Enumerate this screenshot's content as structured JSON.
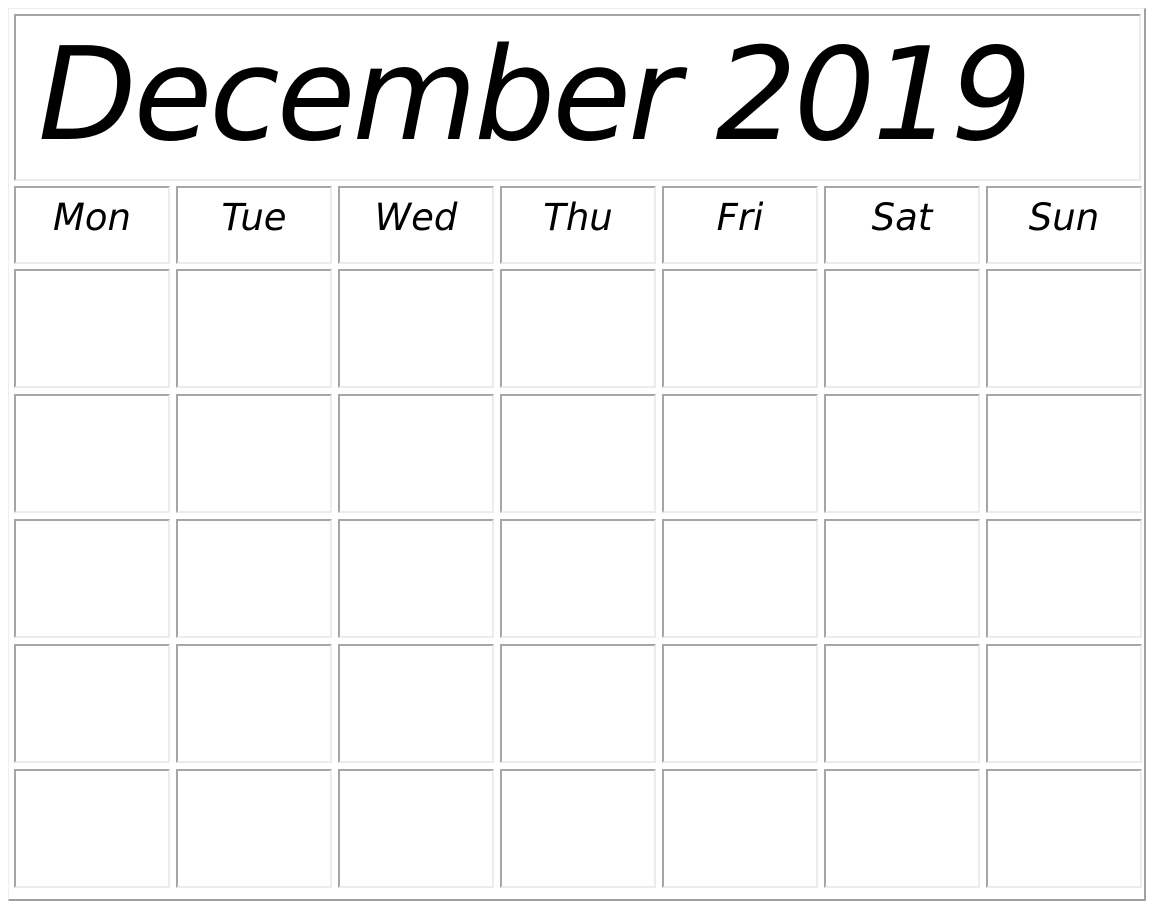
{
  "calendar": {
    "title": "December 2019",
    "month": "December",
    "year": "2019",
    "weekdays": [
      "Mon",
      "Tue",
      "Wed",
      "Thu",
      "Fri",
      "Sat",
      "Sun"
    ],
    "weeks": [
      [
        "",
        "",
        "",
        "",
        "",
        "",
        ""
      ],
      [
        "",
        "",
        "",
        "",
        "",
        "",
        ""
      ],
      [
        "",
        "",
        "",
        "",
        "",
        "",
        ""
      ],
      [
        "",
        "",
        "",
        "",
        "",
        "",
        ""
      ],
      [
        "",
        "",
        "",
        "",
        "",
        "",
        ""
      ]
    ]
  },
  "colors": {
    "text": "#000000",
    "background": "#ffffff",
    "border_dark": "#a6a6a6",
    "border_light": "#ececec"
  }
}
